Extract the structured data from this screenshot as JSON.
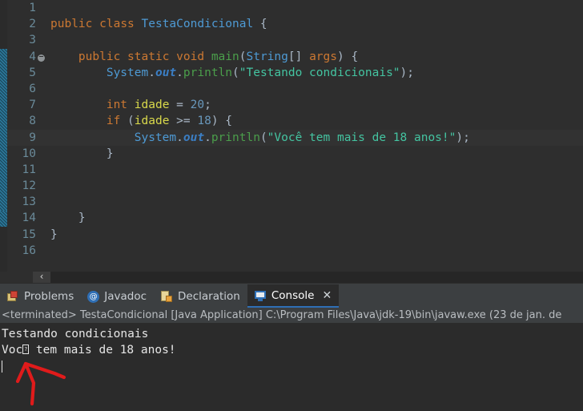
{
  "editor": {
    "language": "java",
    "current_line": 9,
    "fold_marker_lines": [
      4,
      14
    ],
    "lines": [
      {
        "n": "1",
        "tokens": []
      },
      {
        "n": "2",
        "tokens": [
          {
            "t": "public",
            "c": "kw"
          },
          {
            "t": " ",
            "c": "pun"
          },
          {
            "t": "class",
            "c": "kw"
          },
          {
            "t": " ",
            "c": "pun"
          },
          {
            "t": "TestaCondicional",
            "c": "cls"
          },
          {
            "t": " {",
            "c": "pun"
          }
        ]
      },
      {
        "n": "3",
        "tokens": []
      },
      {
        "n": "4",
        "fold": true,
        "tokens": [
          {
            "t": "    ",
            "c": "pun"
          },
          {
            "t": "public",
            "c": "kw"
          },
          {
            "t": " ",
            "c": "pun"
          },
          {
            "t": "static",
            "c": "kw"
          },
          {
            "t": " ",
            "c": "pun"
          },
          {
            "t": "void",
            "c": "kw"
          },
          {
            "t": " ",
            "c": "pun"
          },
          {
            "t": "main",
            "c": "mth"
          },
          {
            "t": "(",
            "c": "pun"
          },
          {
            "t": "String",
            "c": "type"
          },
          {
            "t": "[] ",
            "c": "pun"
          },
          {
            "t": "args",
            "c": "kw"
          },
          {
            "t": ") {",
            "c": "pun"
          }
        ]
      },
      {
        "n": "5",
        "tokens": [
          {
            "t": "        ",
            "c": "pun"
          },
          {
            "t": "System",
            "c": "cls"
          },
          {
            "t": ".",
            "c": "pun"
          },
          {
            "t": "out",
            "c": "fld"
          },
          {
            "t": ".",
            "c": "pun"
          },
          {
            "t": "println",
            "c": "mth"
          },
          {
            "t": "(",
            "c": "pun"
          },
          {
            "t": "\"Testando condicionais\"",
            "c": "str"
          },
          {
            "t": ");",
            "c": "pun"
          }
        ]
      },
      {
        "n": "6",
        "tokens": []
      },
      {
        "n": "7",
        "tokens": [
          {
            "t": "        ",
            "c": "pun"
          },
          {
            "t": "int",
            "c": "kw"
          },
          {
            "t": " ",
            "c": "pun"
          },
          {
            "t": "idade",
            "c": "var"
          },
          {
            "t": " = ",
            "c": "op"
          },
          {
            "t": "20",
            "c": "num"
          },
          {
            "t": ";",
            "c": "pun"
          }
        ]
      },
      {
        "n": "8",
        "tokens": [
          {
            "t": "        ",
            "c": "pun"
          },
          {
            "t": "if",
            "c": "kw"
          },
          {
            "t": " (",
            "c": "pun"
          },
          {
            "t": "idade",
            "c": "var"
          },
          {
            "t": " >= ",
            "c": "op"
          },
          {
            "t": "18",
            "c": "num"
          },
          {
            "t": ") {",
            "c": "pun"
          }
        ]
      },
      {
        "n": "9",
        "tokens": [
          {
            "t": "            ",
            "c": "pun"
          },
          {
            "t": "System",
            "c": "cls"
          },
          {
            "t": ".",
            "c": "pun"
          },
          {
            "t": "out",
            "c": "fld"
          },
          {
            "t": ".",
            "c": "pun"
          },
          {
            "t": "println",
            "c": "mth"
          },
          {
            "t": "(",
            "c": "pun"
          },
          {
            "t": "\"Você tem mais de 18 anos!\"",
            "c": "str"
          },
          {
            "t": ");",
            "c": "pun"
          }
        ]
      },
      {
        "n": "10",
        "tokens": [
          {
            "t": "        }",
            "c": "pun"
          }
        ]
      },
      {
        "n": "11",
        "tokens": []
      },
      {
        "n": "12",
        "tokens": []
      },
      {
        "n": "13",
        "tokens": []
      },
      {
        "n": "14",
        "tokens": [
          {
            "t": "    }",
            "c": "pun"
          }
        ]
      },
      {
        "n": "15",
        "tokens": [
          {
            "t": "}",
            "c": "pun"
          }
        ]
      },
      {
        "n": "16",
        "tokens": []
      }
    ],
    "h_scroll_left_label": "‹"
  },
  "tabbar": {
    "tabs": [
      {
        "label": "Problems",
        "icon": "problems-icon",
        "active": false,
        "closable": false
      },
      {
        "label": "Javadoc",
        "icon": "javadoc-icon",
        "active": false,
        "closable": false,
        "glyph": "@"
      },
      {
        "label": "Declaration",
        "icon": "declaration-icon",
        "active": false,
        "closable": false
      },
      {
        "label": "Console",
        "icon": "console-icon",
        "active": true,
        "closable": true,
        "close_label": "✕"
      }
    ]
  },
  "console": {
    "header": "<terminated> TestaCondicional [Java Application] C:\\Program Files\\Java\\jdk-19\\bin\\javaw.exe  (23 de jan. de",
    "output_line_1": "Testando condicionais",
    "output_line_2_prefix": "Voc",
    "output_line_2_tofu": "?",
    "output_line_2_suffix": " tem mais de 18 anos!"
  },
  "annotation": {
    "type": "hand-drawn-arrow",
    "color": "#e01b1b",
    "points_to": "corrupted-character-in-console-output"
  },
  "colors": {
    "editor_background": "#2e2e2e",
    "current_line": "#323232",
    "gutter_text": "#6a8a99",
    "keyword": "#cc7832",
    "class": "#4e9ad4",
    "method": "#4b9e4b",
    "field": "#3b7ec4",
    "variable": "#d9d94b",
    "number": "#6897bb",
    "string": "#44c4a1",
    "default_text": "#a9b7c6",
    "tabbar_background": "#3c3f41",
    "tab_active_underline": "#2f6fb5",
    "console_background": "#2b2b2b",
    "console_text": "#e6e6e6",
    "fold_strip": "#2d7b9e",
    "annotation_red": "#e01b1b"
  }
}
